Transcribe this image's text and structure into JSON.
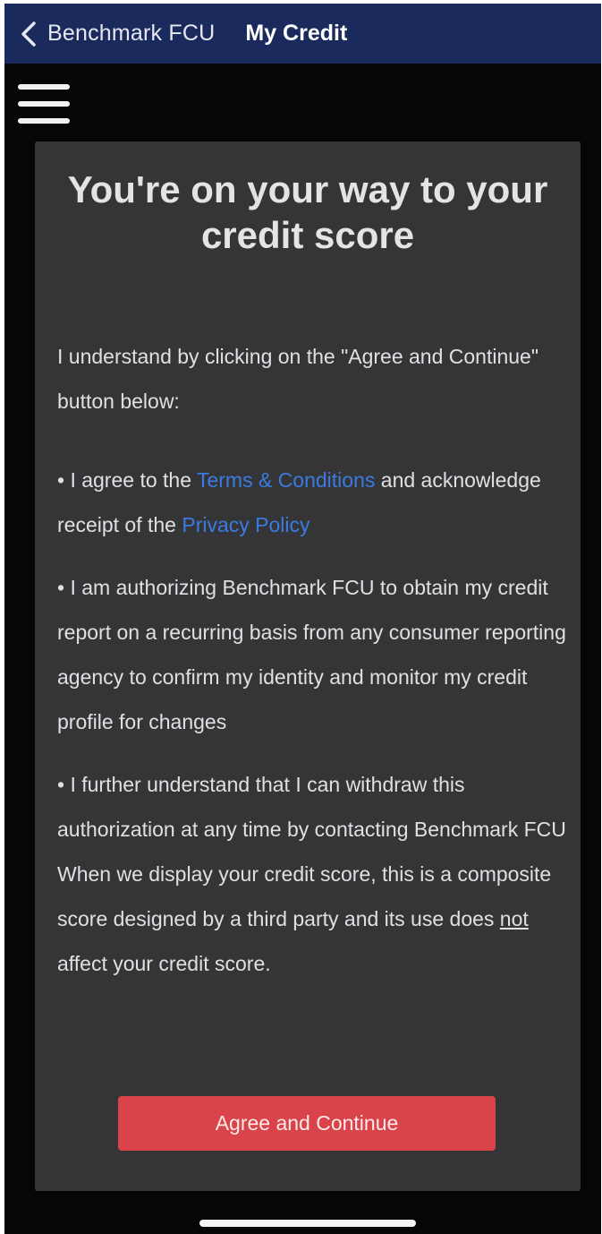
{
  "navbar": {
    "back_label": "Benchmark FCU",
    "title": "My Credit"
  },
  "card": {
    "title": "You're on your way to your credit score",
    "intro": "I understand by clicking on the \"Agree and Continue\" button below:",
    "bullet1": {
      "prefix": "• I agree to the ",
      "terms_link": "Terms & Conditions",
      "middle": " and acknowledge receipt of the ",
      "privacy_link": "Privacy Policy"
    },
    "bullet2": "• I am authorizing Benchmark FCU to obtain my credit report on a recurring basis from any consumer reporting agency to confirm my identity and monitor my credit profile for changes",
    "bullet3": "• I further understand that I can withdraw this authorization at any time by contacting Benchmark FCU",
    "disclaimer": {
      "before": "When we display your credit score, this is a composite score designed by a third party and its use does ",
      "emphasis": "not",
      "after": " affect your credit score."
    },
    "button_label": "Agree and Continue"
  },
  "icons": {
    "back": "chevron-left-icon",
    "menu": "hamburger-menu-icon"
  },
  "colors": {
    "navbar": "#1b2a5c",
    "card": "#353538",
    "link": "#3b7be0",
    "button": "#d9434a"
  }
}
